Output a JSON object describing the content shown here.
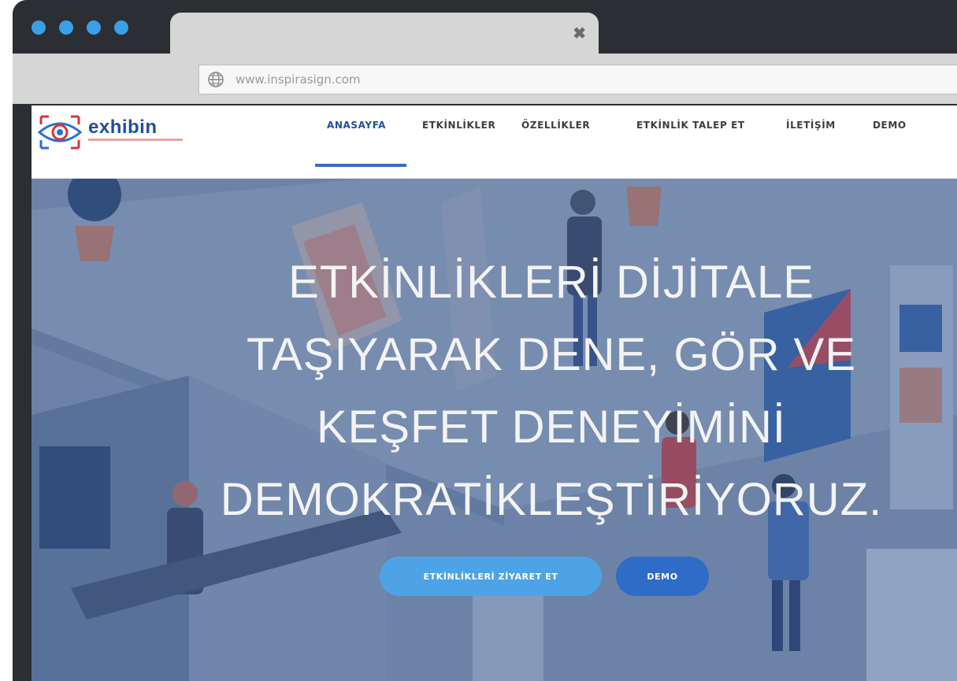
{
  "browser": {
    "tab_close_glyph": "✖",
    "url": "www.inspirasign.com",
    "dot_color": "#3aa0e6"
  },
  "site": {
    "logo_text": "exhibin",
    "nav": [
      {
        "label": "ANASAYFA",
        "active": true
      },
      {
        "label": "ETKİNLİKLER",
        "active": false
      },
      {
        "label": "ÖZELLİKLER",
        "active": false
      },
      {
        "label": "ETKİNLİK TALEP ET",
        "active": false
      },
      {
        "label": "İLETİŞİM",
        "active": false
      },
      {
        "label": "DEMO",
        "active": false
      }
    ],
    "accent_color": "#1f4f9c"
  },
  "hero": {
    "title_lines": [
      "ETKİNLİKLERİ DİJİTALE",
      "TAŞIYARAK DENE, GÖR VE",
      "KEŞFET DENEYİMİNİ",
      "DEMOKRATİKLEŞTİRİYORUZ."
    ],
    "primary_button": "ETKİNLİKLERİ ZİYARET ET",
    "secondary_button": "DEMO",
    "primary_color": "#4ea3e6",
    "secondary_color": "#2f6cc8"
  }
}
